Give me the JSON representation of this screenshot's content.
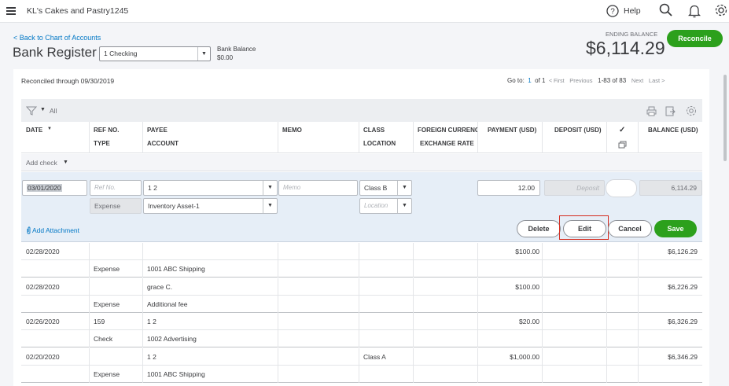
{
  "topbar": {
    "company": "KL's Cakes and Pastry1245",
    "help_label": "Help"
  },
  "header": {
    "back_link": "< Back to Chart of Accounts",
    "title": "Bank Register",
    "account_select": "1 Checking",
    "bank_balance_label": "Bank Balance",
    "bank_balance_value": "$0.00",
    "ending_balance_label": "ENDING BALANCE",
    "ending_balance_value": "$6,114.29",
    "reconcile_label": "Reconcile"
  },
  "register": {
    "reconciled_through": "Reconciled through 09/30/2019",
    "paging": {
      "goto": "Go to:",
      "page": "1",
      "of": "of 1",
      "first": "< First",
      "previous": "Previous",
      "range": "1-83 of 83",
      "next": "Next",
      "last": "Last >"
    },
    "filter_label": "All",
    "columns": {
      "date": "DATE",
      "ref_no": "REF NO.",
      "type": "TYPE",
      "payee": "PAYEE",
      "account": "ACCOUNT",
      "memo": "MEMO",
      "class": "CLASS",
      "location": "LOCATION",
      "foreign_currency": "FOREIGN CURRENC",
      "exchange_rate": "EXCHANGE RATE",
      "payment": "PAYMENT (USD)",
      "deposit": "DEPOSIT (USD)",
      "balance": "BALANCE (USD)"
    },
    "add_check_label": "Add check",
    "edit_row": {
      "date": "03/01/2020",
      "ref_placeholder": "Ref No.",
      "type": "Expense",
      "payee": "1 2",
      "account": "Inventory Asset-1",
      "memo_placeholder": "Memo",
      "class": "Class B",
      "location_placeholder": "Location",
      "payment": "12.00",
      "deposit_placeholder": "Deposit",
      "balance": "6,114.29",
      "add_attachment": "Add Attachment",
      "delete_label": "Delete",
      "edit_label": "Edit",
      "cancel_label": "Cancel",
      "save_label": "Save"
    },
    "rows": [
      {
        "date": "02/28/2020",
        "ref": "",
        "type": "Expense",
        "payee": "",
        "account": "1001 ABC Shipping",
        "class": "",
        "payment": "$100.00",
        "balance": "$6,126.29"
      },
      {
        "date": "02/28/2020",
        "ref": "",
        "type": "Expense",
        "payee": "grace C.",
        "account": "Additional fee",
        "class": "",
        "payment": "$100.00",
        "balance": "$6,226.29"
      },
      {
        "date": "02/26/2020",
        "ref": "159",
        "type": "Check",
        "payee": "1 2",
        "account": "1002 Advertising",
        "class": "",
        "payment": "$20.00",
        "balance": "$6,326.29"
      },
      {
        "date": "02/20/2020",
        "ref": "",
        "type": "Expense",
        "payee": "1 2",
        "account": "1001 ABC Shipping",
        "class": "Class A",
        "payment": "$1,000.00",
        "balance": "$6,346.29"
      }
    ]
  },
  "colors": {
    "brand_green": "#2ca01c",
    "link_blue": "#0077c5",
    "highlight_red": "#d52b1e"
  }
}
